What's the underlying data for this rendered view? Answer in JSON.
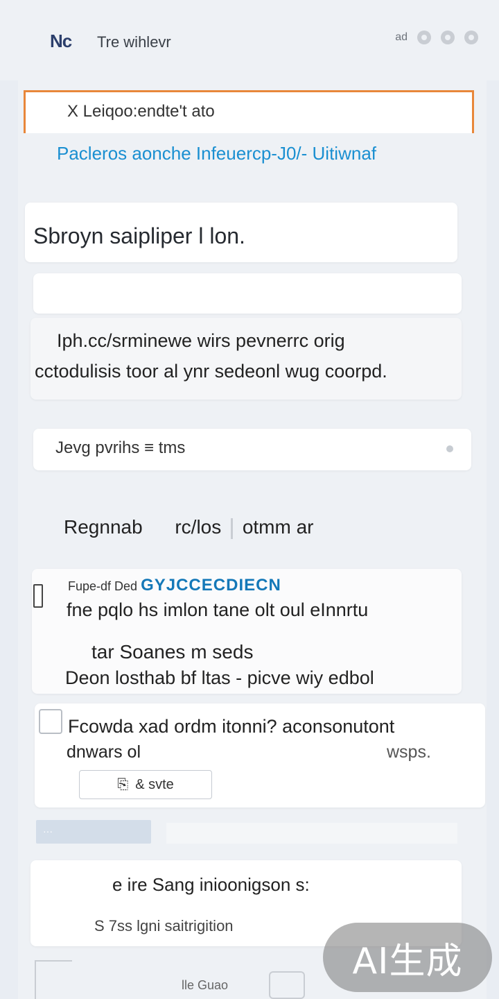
{
  "header": {
    "logo": "Nc",
    "title": "Tre wihlevr",
    "right_label": "ad",
    "icons": [
      "account-icon",
      "settings-icon",
      "notification-icon"
    ]
  },
  "hero": {
    "title": "X Leiqoo:endte't ato",
    "subtitle": "Pacleros aonche Infeuercp-J0/- Uitiwnaf"
  },
  "prompt": {
    "text": "Sbroyn saipliper l lon."
  },
  "description": {
    "line1": "Iph.cc/srminewe wirs pevnerrc orig",
    "line2": "cctodulisis toor al ynr sedeonl wug coorpd."
  },
  "selector": {
    "value": "Jevg pvrihs ≡ tms"
  },
  "section": {
    "part1": "Regnnab",
    "part2": "rc/los",
    "part3": "otmm ar"
  },
  "item": {
    "meta_prefix": "Fupe-df Ded",
    "meta_accent": "GYJCCECDIECN",
    "line1": "fne pqlo hs imlon tane olt oul eInnrtu",
    "line2": "tar Soanes m seds",
    "line3": "Deon losthab bf ltas - picve wiy edbol"
  },
  "quote": {
    "line1": "Fcowda xad ordm itonni? aconsonutont",
    "line2_left": "dnwars ol",
    "line2_right": "wsps."
  },
  "save_button": {
    "label": "& svte"
  },
  "tag": {
    "label": "···"
  },
  "related": {
    "title": "e ire Sang inioonigson s:",
    "subtitle": "S 7ss lgni saitrigition"
  },
  "footer": {
    "label": "lle Guao"
  },
  "watermark": {
    "text": "AI生成"
  },
  "colors": {
    "accent_orange": "#e8873a",
    "accent_blue": "#1a8fd1",
    "background": "#eef1f5"
  }
}
